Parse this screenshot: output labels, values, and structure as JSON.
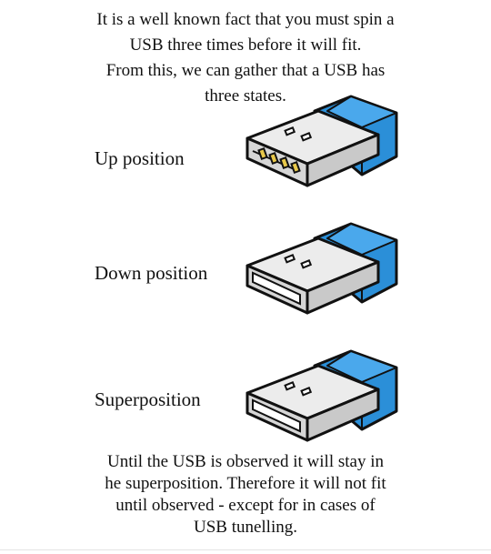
{
  "intro": {
    "lines": [
      "It is a well known fact that you must spin a",
      "USB three times before it will fit.",
      "From this, we can gather that a USB has",
      "three states."
    ]
  },
  "states": [
    {
      "label": "Up position",
      "connector": "up-contacts-visible-icon"
    },
    {
      "label": "Down position",
      "connector": "down-contacts-hidden-icon"
    },
    {
      "label": "Superposition",
      "connector": "superposition-contacts-hidden-icon"
    }
  ],
  "outro": {
    "lines": [
      "Until the USB is observed it will stay in",
      "he superposition. Therefore it will not fit",
      "until observed - except for in cases of",
      "USB tunelling."
    ]
  },
  "colors": {
    "usb_blue": "#2b8fd8",
    "usb_blue_dark": "#1f6fb0",
    "metal": "#e9e9e9",
    "metal_shade": "#cfcfcf",
    "contact_gold": "#e8c84a",
    "outline": "#111111"
  }
}
